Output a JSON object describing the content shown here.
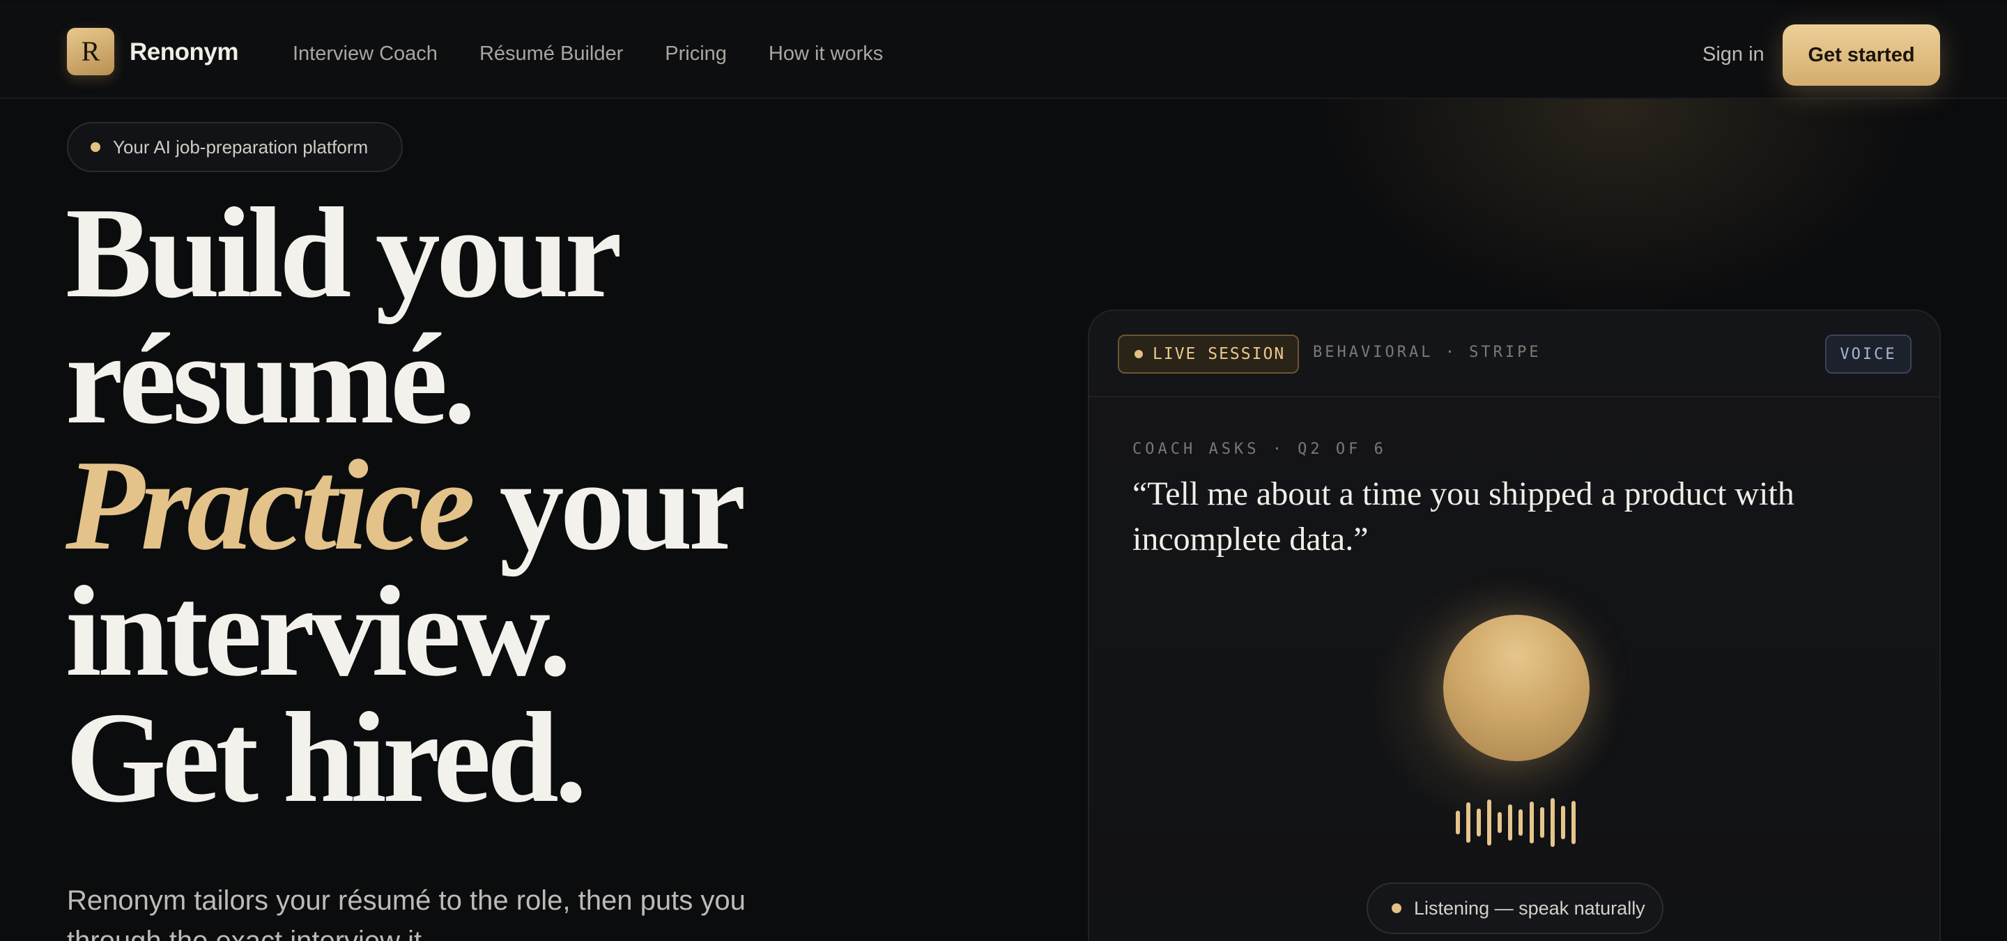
{
  "nav": {
    "logo_letter": "R",
    "brand": "Renonym",
    "links": [
      "Interview Coach",
      "Résumé Builder",
      "Pricing",
      "How it works"
    ],
    "sign_in": "Sign in",
    "cta": "Get started"
  },
  "hero": {
    "pill": "Your AI job-preparation platform",
    "headline": {
      "line1": "Build your",
      "line2": "résumé.",
      "line3_emphasis": "Practice",
      "line3_rest": " your",
      "line4": "interview.",
      "line5": "Get hired."
    },
    "subtext": "Renonym tailors your résumé to the role, then puts you through the exact interview it"
  },
  "session_card": {
    "live_label": "LIVE SESSION",
    "meta": "BEHAVIORAL · STRIPE",
    "mode_badge": "VOICE",
    "coach_label": "COACH ASKS · Q2 OF 6",
    "question": "“Tell me about a time you shipped a product with incomplete data.”",
    "status": "Listening — speak naturally"
  },
  "colors": {
    "accent_gold": "#e3c38a",
    "background": "#0b0c0e",
    "voice_badge": "#a7b6d6"
  }
}
